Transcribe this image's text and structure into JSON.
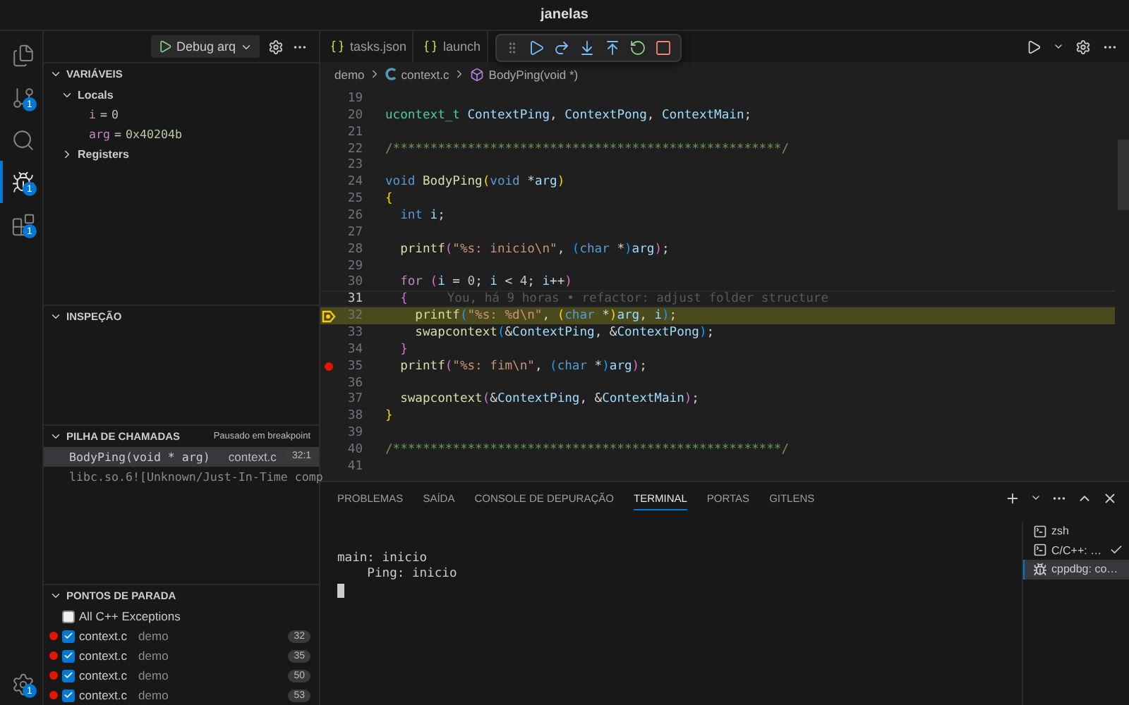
{
  "window": {
    "title": "janelas"
  },
  "activity_bar": {
    "items": [
      {
        "kind": "files",
        "selected": false
      },
      {
        "kind": "source-control",
        "badge": "1",
        "selected": false
      },
      {
        "kind": "search",
        "selected": false
      },
      {
        "kind": "debug",
        "badge": "1",
        "selected": true
      },
      {
        "kind": "extensions",
        "badge": "1",
        "selected": false
      }
    ],
    "settings": {
      "badge": "1"
    }
  },
  "debug_header": {
    "configuration": "Debug arq"
  },
  "variables": {
    "title": "VARIÁVEIS",
    "groups": [
      {
        "label": "Locals",
        "expanded": true,
        "children": [
          {
            "name": "i",
            "operator": "=",
            "value": "0"
          },
          {
            "name": "arg",
            "operator": "=",
            "value": "0x40204b"
          }
        ]
      },
      {
        "label": "Registers",
        "expanded": false
      }
    ]
  },
  "watch": {
    "title": "INSPEÇÃO"
  },
  "call_stack": {
    "title": "PILHA DE CHAMADAS",
    "status": "Pausado em breakpoint",
    "frames": [
      {
        "name": "BodyPing(void * arg)",
        "file": "context.c",
        "position": "32:1",
        "selected": true
      },
      {
        "name": "libc.so.6![Unknown/Just-In-Time comp",
        "selected": false
      }
    ]
  },
  "breakpoints": {
    "title": "PONTOS DE PARADA",
    "items": [
      {
        "kind": "exception",
        "label": "All C++ Exceptions",
        "checked": false
      },
      {
        "kind": "line",
        "file": "context.c",
        "folder": "demo",
        "line": "32",
        "checked": true
      },
      {
        "kind": "line",
        "file": "context.c",
        "folder": "demo",
        "line": "35",
        "checked": true
      },
      {
        "kind": "line",
        "file": "context.c",
        "folder": "demo",
        "line": "50",
        "checked": true
      },
      {
        "kind": "line",
        "file": "context.c",
        "folder": "demo",
        "line": "53",
        "checked": true
      }
    ]
  },
  "editor": {
    "tabs": [
      {
        "label": "tasks.json",
        "selected": false
      },
      {
        "label": "launch",
        "selected": false
      }
    ],
    "debug_toolbar": [
      {
        "kind": "continue"
      },
      {
        "kind": "step-over"
      },
      {
        "kind": "step-into"
      },
      {
        "kind": "step-out"
      },
      {
        "kind": "restart"
      },
      {
        "kind": "stop"
      }
    ],
    "breadcrumb": [
      {
        "kind": "folder",
        "label": "demo"
      },
      {
        "kind": "file",
        "label": "context.c"
      },
      {
        "kind": "symbol",
        "label": "BodyPing(void *)"
      }
    ],
    "code": {
      "lines": [
        {
          "number": "19",
          "cursor": false,
          "current": false,
          "breakpoint": false
        },
        {
          "number": "20",
          "cursor": false,
          "current": false,
          "breakpoint": false,
          "tokens": [
            {
              "kind": "type",
              "text": "ucontext_t "
            },
            {
              "kind": "var",
              "text": "ContextPing"
            },
            {
              "kind": "plain",
              "text": ", "
            },
            {
              "kind": "var",
              "text": "ContextPong"
            },
            {
              "kind": "plain",
              "text": ", "
            },
            {
              "kind": "var",
              "text": "ContextMain"
            },
            {
              "kind": "plain",
              "text": ";"
            }
          ]
        },
        {
          "number": "21",
          "cursor": false,
          "current": false,
          "breakpoint": false
        },
        {
          "number": "22",
          "cursor": false,
          "current": false,
          "breakpoint": false,
          "tokens": [
            {
              "kind": "comment",
              "text": "/****************************************************/"
            }
          ]
        },
        {
          "number": "23",
          "cursor": false,
          "current": false,
          "breakpoint": false
        },
        {
          "number": "24",
          "cursor": false,
          "current": false,
          "breakpoint": false,
          "tokens": [
            {
              "kind": "kw",
              "text": "void "
            },
            {
              "kind": "fn",
              "text": "BodyPing"
            },
            {
              "kind": "b1",
              "text": "("
            },
            {
              "kind": "kw",
              "text": "void"
            },
            {
              "kind": "plain",
              "text": " *"
            },
            {
              "kind": "var",
              "text": "arg"
            },
            {
              "kind": "b1",
              "text": ")"
            }
          ]
        },
        {
          "number": "25",
          "cursor": false,
          "current": false,
          "breakpoint": false,
          "tokens": [
            {
              "kind": "b1",
              "text": "{"
            }
          ]
        },
        {
          "number": "26",
          "cursor": false,
          "current": false,
          "breakpoint": false,
          "tokens": [
            {
              "kind": "kw",
              "text": "  int "
            },
            {
              "kind": "var",
              "text": "i"
            },
            {
              "kind": "plain",
              "text": ";"
            }
          ]
        },
        {
          "number": "27",
          "cursor": false,
          "current": false,
          "breakpoint": false
        },
        {
          "number": "28",
          "cursor": false,
          "current": false,
          "breakpoint": false,
          "tokens": [
            {
              "kind": "fn",
              "text": "  printf"
            },
            {
              "kind": "b2",
              "text": "("
            },
            {
              "kind": "str",
              "text": "\"%s: inicio\\n\""
            },
            {
              "kind": "plain",
              "text": ", "
            },
            {
              "kind": "b3",
              "text": "("
            },
            {
              "kind": "kw",
              "text": "char"
            },
            {
              "kind": "plain",
              "text": " *"
            },
            {
              "kind": "b3",
              "text": ")"
            },
            {
              "kind": "var",
              "text": "arg"
            },
            {
              "kind": "b2",
              "text": ")"
            },
            {
              "kind": "plain",
              "text": ";"
            }
          ]
        },
        {
          "number": "29",
          "cursor": false,
          "current": false,
          "breakpoint": false
        },
        {
          "number": "30",
          "cursor": false,
          "current": false,
          "breakpoint": false,
          "tokens": [
            {
              "kind": "ctrl",
              "text": "  for "
            },
            {
              "kind": "b2",
              "text": "("
            },
            {
              "kind": "var",
              "text": "i"
            },
            {
              "kind": "plain",
              "text": " = "
            },
            {
              "kind": "num",
              "text": "0"
            },
            {
              "kind": "plain",
              "text": "; "
            },
            {
              "kind": "var",
              "text": "i"
            },
            {
              "kind": "plain",
              "text": " < "
            },
            {
              "kind": "num",
              "text": "4"
            },
            {
              "kind": "plain",
              "text": "; "
            },
            {
              "kind": "var",
              "text": "i"
            },
            {
              "kind": "plain",
              "text": "++"
            },
            {
              "kind": "b2",
              "text": ")"
            }
          ]
        },
        {
          "number": "31",
          "cursor": true,
          "current": false,
          "breakpoint": false,
          "blame": "You, há 9 horas • refactor: adjust folder structure",
          "tokens": [
            {
              "kind": "b2",
              "text": "  {"
            }
          ]
        },
        {
          "number": "32",
          "cursor": false,
          "current": true,
          "breakpoint": true,
          "tokens": [
            {
              "kind": "fn",
              "text": "    printf"
            },
            {
              "kind": "b3",
              "text": "("
            },
            {
              "kind": "str",
              "text": "\"%s: %d\\n\""
            },
            {
              "kind": "plain",
              "text": ", "
            },
            {
              "kind": "b1",
              "text": "("
            },
            {
              "kind": "kw",
              "text": "char"
            },
            {
              "kind": "plain",
              "text": " *"
            },
            {
              "kind": "b1",
              "text": ")"
            },
            {
              "kind": "var",
              "text": "arg"
            },
            {
              "kind": "plain",
              "text": ", "
            },
            {
              "kind": "var",
              "text": "i"
            },
            {
              "kind": "b3",
              "text": ")"
            },
            {
              "kind": "plain",
              "text": ";"
            }
          ]
        },
        {
          "number": "33",
          "cursor": false,
          "current": false,
          "breakpoint": false,
          "tokens": [
            {
              "kind": "fn",
              "text": "    swapcontext"
            },
            {
              "kind": "b3",
              "text": "("
            },
            {
              "kind": "plain",
              "text": "&"
            },
            {
              "kind": "var",
              "text": "ContextPing"
            },
            {
              "kind": "plain",
              "text": ", &"
            },
            {
              "kind": "var",
              "text": "ContextPong"
            },
            {
              "kind": "b3",
              "text": ")"
            },
            {
              "kind": "plain",
              "text": ";"
            }
          ]
        },
        {
          "number": "34",
          "cursor": false,
          "current": false,
          "breakpoint": false,
          "tokens": [
            {
              "kind": "b2",
              "text": "  }"
            }
          ]
        },
        {
          "number": "35",
          "cursor": false,
          "current": false,
          "breakpoint": true,
          "tokens": [
            {
              "kind": "fn",
              "text": "  printf"
            },
            {
              "kind": "b2",
              "text": "("
            },
            {
              "kind": "str",
              "text": "\"%s: fim\\n\""
            },
            {
              "kind": "plain",
              "text": ", "
            },
            {
              "kind": "b3",
              "text": "("
            },
            {
              "kind": "kw",
              "text": "char"
            },
            {
              "kind": "plain",
              "text": " *"
            },
            {
              "kind": "b3",
              "text": ")"
            },
            {
              "kind": "var",
              "text": "arg"
            },
            {
              "kind": "b2",
              "text": ")"
            },
            {
              "kind": "plain",
              "text": ";"
            }
          ]
        },
        {
          "number": "36",
          "cursor": false,
          "current": false,
          "breakpoint": false
        },
        {
          "number": "37",
          "cursor": false,
          "current": false,
          "breakpoint": false,
          "tokens": [
            {
              "kind": "fn",
              "text": "  swapcontext"
            },
            {
              "kind": "b2",
              "text": "("
            },
            {
              "kind": "plain",
              "text": "&"
            },
            {
              "kind": "var",
              "text": "ContextPing"
            },
            {
              "kind": "plain",
              "text": ", &"
            },
            {
              "kind": "var",
              "text": "ContextMain"
            },
            {
              "kind": "b2",
              "text": ")"
            },
            {
              "kind": "plain",
              "text": ";"
            }
          ]
        },
        {
          "number": "38",
          "cursor": false,
          "current": false,
          "breakpoint": false,
          "tokens": [
            {
              "kind": "b1",
              "text": "}"
            }
          ]
        },
        {
          "number": "39",
          "cursor": false,
          "current": false,
          "breakpoint": false
        },
        {
          "number": "40",
          "cursor": false,
          "current": false,
          "breakpoint": false,
          "tokens": [
            {
              "kind": "comment",
              "text": "/****************************************************/"
            }
          ]
        },
        {
          "number": "41",
          "cursor": false,
          "current": false,
          "breakpoint": false
        }
      ]
    }
  },
  "panel": {
    "tabs": [
      {
        "label": "PROBLEMAS",
        "selected": false
      },
      {
        "label": "SAÍDA",
        "selected": false
      },
      {
        "label": "CONSOLE DE DEPURAÇÃO",
        "selected": false
      },
      {
        "label": "TERMINAL",
        "selected": true
      },
      {
        "label": "PORTAS",
        "selected": false
      },
      {
        "label": "GITLENS",
        "selected": false
      }
    ],
    "terminal_output": [
      "main: inicio",
      "    Ping: inicio"
    ],
    "terminals": [
      {
        "kind": "shell",
        "label": "zsh",
        "done": false,
        "selected": false
      },
      {
        "kind": "shell",
        "label": "C/C++: …",
        "done": true,
        "selected": false
      },
      {
        "kind": "debug",
        "label": "cppdbg: co…",
        "done": false,
        "selected": true
      }
    ]
  }
}
